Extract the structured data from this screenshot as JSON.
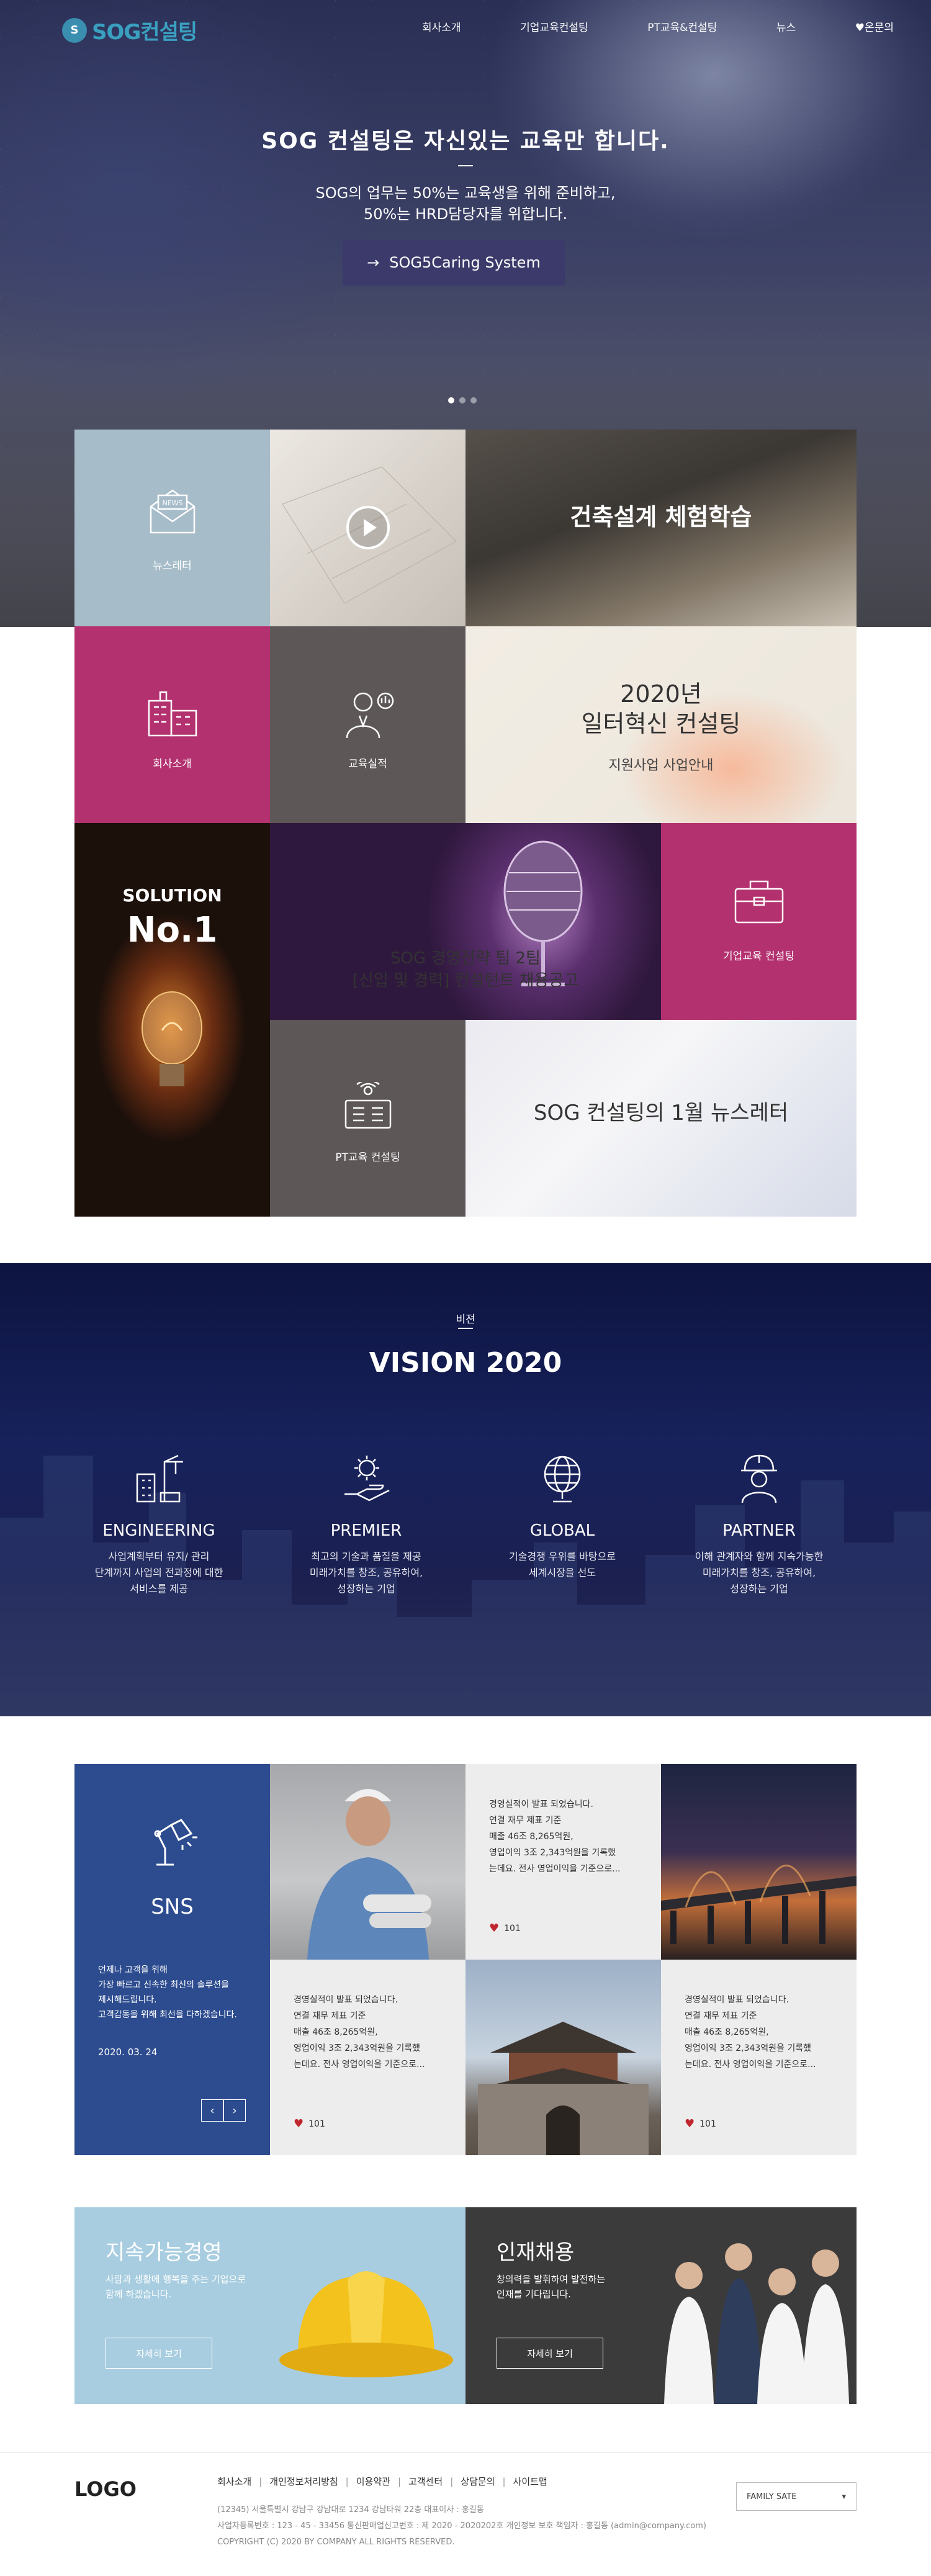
{
  "header": {
    "logo_mark": "S",
    "logo_text": "SOG컨설팅",
    "nav": [
      "회사소개",
      "기업교육컨설팅",
      "PT교육&컨설팅",
      "뉴스",
      "♥온문의"
    ]
  },
  "hero": {
    "title": "SOG 컨설팅은 자신있는 교육만 합니다.",
    "subtitle_1": "SOG의 업무는 50%는 교육생을 위해 준비하고,",
    "subtitle_2": "50%는 HRD담당자를 위합니다.",
    "button_arrow": "→",
    "button_label": "SOG5Caring System",
    "slide_count": 3,
    "active_slide": 1
  },
  "tiles": {
    "news_label": "뉴스레터",
    "news_icon_text": "NEWS",
    "arch_title": "건축설계 체험학습",
    "company_label": "회사소개",
    "perf_label": "교육실적",
    "innov_title_1": "2020년",
    "innov_title_2": "일터혁신 컨설팅",
    "innov_sub": "지원사업 사업안내",
    "solution_1": "SOLUTION",
    "solution_2": "No.1",
    "recruit_title_1": "SOG 경영전략 팀 2팀",
    "recruit_title_2": "[신입 및 경력] 컨설턴트 채용공고",
    "edu_label": "기업교육 컨설팅",
    "pt_label": "PT교육 컨설팅",
    "letter_title": "SOG 컨설팅의 1월 뉴스레터"
  },
  "vision": {
    "tag": "비젼",
    "title": "VISION 2020",
    "items": [
      {
        "icon": "building-crane-icon",
        "title": "ENGINEERING",
        "desc_1": "사업계획부터 유지/ 관리",
        "desc_2": "단계까지 사업의 전과정에 대한",
        "desc_3": "서비스를 제공"
      },
      {
        "icon": "gear-hand-icon",
        "title": "PREMIER",
        "desc_1": "최고의 기술과 품질을 제공",
        "desc_2": "미래가치를 창조, 공유하여,",
        "desc_3": "성장하는 기업"
      },
      {
        "icon": "globe-icon",
        "title": "GLOBAL",
        "desc_1": "기술경쟁 우위를 바탕으로",
        "desc_2": "세계시장을 선도",
        "desc_3": ""
      },
      {
        "icon": "engineer-helmet-icon",
        "title": "PARTNER",
        "desc_1": "이해 관계자와 함께 지속가능한",
        "desc_2": "미래가치를 창조, 공유하여,",
        "desc_3": "성장하는 기업"
      }
    ]
  },
  "sns": {
    "title": "SNS",
    "desc_1": "언제나 고객을 위해",
    "desc_2": "가장 빠르고 신속한 최신의 솔루션을",
    "desc_3": "제시해드립니다.",
    "desc_4": "고객감동을 위해 최선을 다하겠습니다.",
    "date": "2020. 03. 24",
    "prev": "‹",
    "next": "›",
    "post": {
      "line_1": "경영실적이 발표 되었습니다.",
      "line_2": "연결 재무 제표 기준",
      "line_3": "매출 46조 8,265억원,",
      "line_4": "영업이익 3조 2,343억원을 기록했",
      "line_5": "는데요. 전사 영업이익을 기준으로..."
    },
    "likes": "101",
    "heart": "♥"
  },
  "banners": {
    "sustain": {
      "title": "지속가능경영",
      "desc_1": "사람과 생활에 행복을 주는 기업으로",
      "desc_2": "함께 하겠습니다.",
      "button": "자세히 보기"
    },
    "recruit": {
      "title": "인재채용",
      "desc_1": "창의력을 발휘하여 발전하는",
      "desc_2": "인재를 기다립니다.",
      "button": "자세히 보기"
    }
  },
  "footer": {
    "logo": "LOGO",
    "links": [
      "회사소개",
      "개인정보처리방침",
      "이용약관",
      "고객센터",
      "상담문의",
      "사이트맵"
    ],
    "info_1": "(12345) 서울특별시 강남구 강남대로 1234 강남타워 22층 대표이사 : 홍길동",
    "info_2": "사업자등록번호 : 123 - 45 - 33456 통신판매업신고번호 : 제 2020 - 2020202호 개인정보 보호 책임자 : 홍길동 (admin@company.com)",
    "info_3": "COPYRIGHT (C) 2020 BY COMPANY ALL RIGHTS RESERVED.",
    "family_site": "FAMILY SATE",
    "family_arrow": "▾"
  }
}
